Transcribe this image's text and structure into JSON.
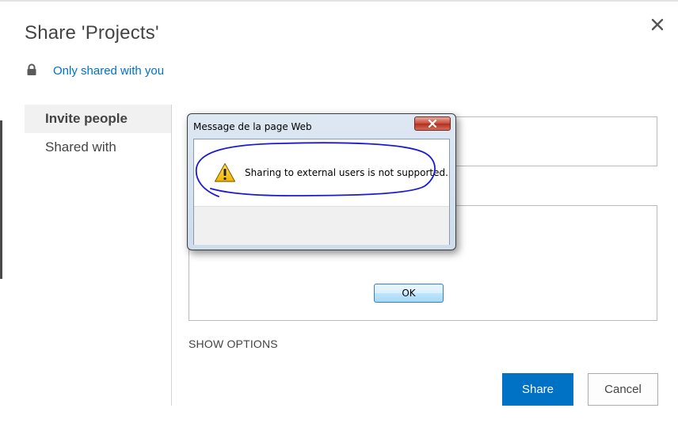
{
  "dialog": {
    "title": "Share 'Projects'",
    "sharing_status": "Only shared with you",
    "nav": {
      "items": [
        {
          "label": "Invite people",
          "selected": true
        },
        {
          "label": "Shared with",
          "selected": false
        }
      ]
    },
    "invite_field": {
      "value": ""
    },
    "message_field": {
      "value": ""
    },
    "show_options_label": "SHOW OPTIONS",
    "share_label": "Share",
    "cancel_label": "Cancel",
    "icons": {
      "close": "close-icon",
      "lock": "lock-icon"
    }
  },
  "alert": {
    "title": "Message de la page Web",
    "message": "Sharing to external users is not supported.",
    "ok_label": "OK",
    "icons": {
      "warning": "warning-icon",
      "close": "close-icon"
    },
    "annotation_color": "#1a1ad6"
  },
  "colors": {
    "accent": "#0072c6",
    "text": "#444444",
    "border": "#bbbbbb"
  }
}
